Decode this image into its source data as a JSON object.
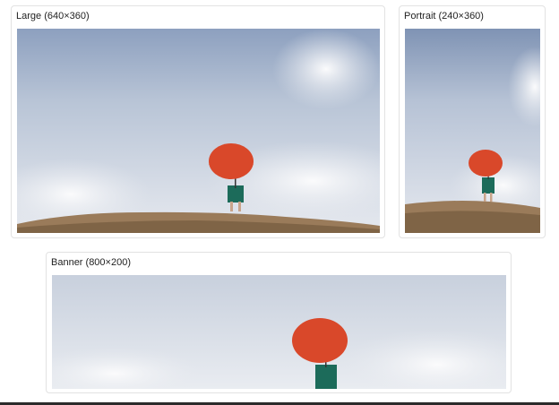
{
  "cards": [
    {
      "title": "Large (640×360)"
    },
    {
      "title": "Portrait (240×360)"
    },
    {
      "title": "Banner (800×200)"
    }
  ],
  "image": {
    "umbrella_color": "#d9482a",
    "dress_color": "#1c6b5a",
    "sky_color": "#b9c5d6",
    "ground_color": "#9a7b5a"
  }
}
